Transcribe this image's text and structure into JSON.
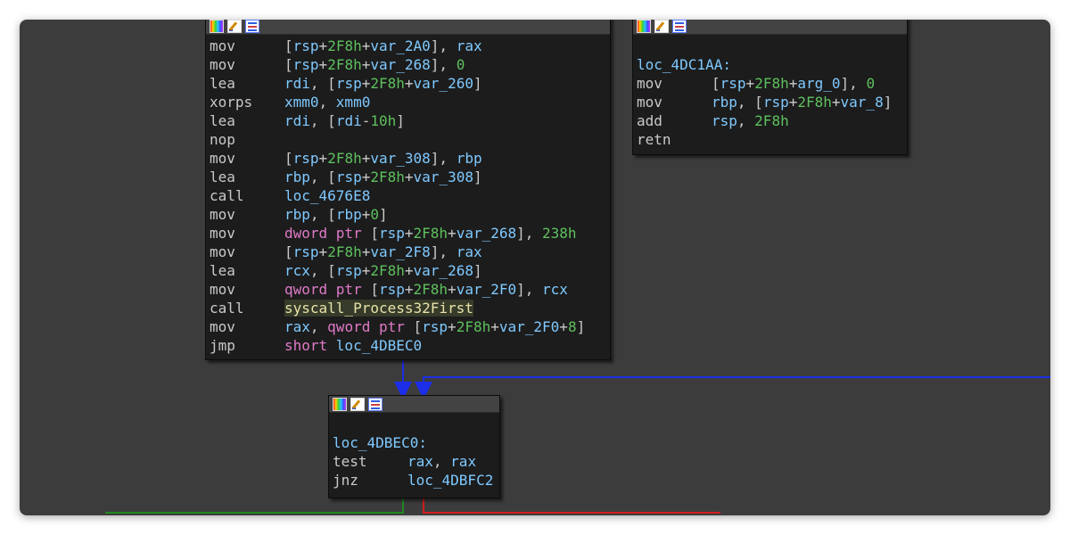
{
  "colors": {
    "canvas": "#3c3c3c",
    "node_bg": "#1c1c1c",
    "node_header": "#434343",
    "text": "#c9c9c9",
    "identifier": "#7fc9ff",
    "number": "#5ec05e",
    "keyword": "#e07ac8",
    "edge_unconditional": "#1c2ee8",
    "edge_true": "#1f8a1f",
    "edge_false": "#d21c1c"
  },
  "node_toolbar_icons": [
    "colors-icon",
    "rename-icon",
    "graph-overview-icon"
  ],
  "node_main": {
    "lines": [
      {
        "m": "mov",
        "ops": [
          [
            "br",
            "["
          ],
          [
            "reg",
            "rsp"
          ],
          [
            "t",
            "+"
          ],
          [
            "num",
            "2F8h"
          ],
          [
            "t",
            "+"
          ],
          [
            "id",
            "var_2A0"
          ],
          [
            "br",
            "], "
          ],
          [
            "reg",
            "rax"
          ]
        ]
      },
      {
        "m": "mov",
        "ops": [
          [
            "br",
            "["
          ],
          [
            "reg",
            "rsp"
          ],
          [
            "t",
            "+"
          ],
          [
            "num",
            "2F8h"
          ],
          [
            "t",
            "+"
          ],
          [
            "id",
            "var_268"
          ],
          [
            "br",
            "], "
          ],
          [
            "num",
            "0"
          ]
        ]
      },
      {
        "m": "lea",
        "ops": [
          [
            "reg",
            "rdi"
          ],
          [
            "t",
            ", ["
          ],
          [
            "reg",
            "rsp"
          ],
          [
            "t",
            "+"
          ],
          [
            "num",
            "2F8h"
          ],
          [
            "t",
            "+"
          ],
          [
            "id",
            "var_260"
          ],
          [
            "t",
            "]"
          ]
        ]
      },
      {
        "m": "xorps",
        "ops": [
          [
            "reg",
            "xmm0"
          ],
          [
            "t",
            ", "
          ],
          [
            "reg",
            "xmm0"
          ]
        ]
      },
      {
        "m": "lea",
        "ops": [
          [
            "reg",
            "rdi"
          ],
          [
            "t",
            ", ["
          ],
          [
            "reg",
            "rdi"
          ],
          [
            "t",
            "-"
          ],
          [
            "num",
            "10h"
          ],
          [
            "t",
            "]"
          ]
        ]
      },
      {
        "m": "nop",
        "ops": []
      },
      {
        "m": "mov",
        "ops": [
          [
            "br",
            "["
          ],
          [
            "reg",
            "rsp"
          ],
          [
            "t",
            "+"
          ],
          [
            "num",
            "2F8h"
          ],
          [
            "t",
            "+"
          ],
          [
            "id",
            "var_308"
          ],
          [
            "br",
            "], "
          ],
          [
            "reg",
            "rbp"
          ]
        ]
      },
      {
        "m": "lea",
        "ops": [
          [
            "reg",
            "rbp"
          ],
          [
            "t",
            ", ["
          ],
          [
            "reg",
            "rsp"
          ],
          [
            "t",
            "+"
          ],
          [
            "num",
            "2F8h"
          ],
          [
            "t",
            "+"
          ],
          [
            "id",
            "var_308"
          ],
          [
            "t",
            "]"
          ]
        ]
      },
      {
        "m": "call",
        "ops": [
          [
            "id",
            "loc_4676E8"
          ]
        ]
      },
      {
        "m": "mov",
        "ops": [
          [
            "reg",
            "rbp"
          ],
          [
            "t",
            ", ["
          ],
          [
            "reg",
            "rbp"
          ],
          [
            "t",
            "+"
          ],
          [
            "num",
            "0"
          ],
          [
            "t",
            "]"
          ]
        ]
      },
      {
        "m": "mov",
        "ops": [
          [
            "kw",
            "dword ptr "
          ],
          [
            "t",
            "["
          ],
          [
            "reg",
            "rsp"
          ],
          [
            "t",
            "+"
          ],
          [
            "num",
            "2F8h"
          ],
          [
            "t",
            "+"
          ],
          [
            "id",
            "var_268"
          ],
          [
            "t",
            "], "
          ],
          [
            "num",
            "238h"
          ]
        ]
      },
      {
        "m": "mov",
        "ops": [
          [
            "br",
            "["
          ],
          [
            "reg",
            "rsp"
          ],
          [
            "t",
            "+"
          ],
          [
            "num",
            "2F8h"
          ],
          [
            "t",
            "+"
          ],
          [
            "id",
            "var_2F8"
          ],
          [
            "br",
            "], "
          ],
          [
            "reg",
            "rax"
          ]
        ]
      },
      {
        "m": "lea",
        "ops": [
          [
            "reg",
            "rcx"
          ],
          [
            "t",
            ", ["
          ],
          [
            "reg",
            "rsp"
          ],
          [
            "t",
            "+"
          ],
          [
            "num",
            "2F8h"
          ],
          [
            "t",
            "+"
          ],
          [
            "id",
            "var_268"
          ],
          [
            "t",
            "]"
          ]
        ]
      },
      {
        "m": "mov",
        "ops": [
          [
            "kw",
            "qword ptr "
          ],
          [
            "t",
            "["
          ],
          [
            "reg",
            "rsp"
          ],
          [
            "t",
            "+"
          ],
          [
            "num",
            "2F8h"
          ],
          [
            "t",
            "+"
          ],
          [
            "id",
            "var_2F0"
          ],
          [
            "t",
            "], "
          ],
          [
            "reg",
            "rcx"
          ]
        ]
      },
      {
        "m": "call",
        "ops": [
          [
            "hl",
            "syscall_Process32First"
          ]
        ]
      },
      {
        "m": "mov",
        "ops": [
          [
            "reg",
            "rax"
          ],
          [
            "t",
            ", "
          ],
          [
            "kw",
            "qword ptr "
          ],
          [
            "t",
            "["
          ],
          [
            "reg",
            "rsp"
          ],
          [
            "t",
            "+"
          ],
          [
            "num",
            "2F8h"
          ],
          [
            "t",
            "+"
          ],
          [
            "id",
            "var_2F0"
          ],
          [
            "t",
            "+"
          ],
          [
            "num",
            "8"
          ],
          [
            "t",
            "]"
          ]
        ]
      },
      {
        "m": "jmp",
        "ops": [
          [
            "kw",
            "short "
          ],
          [
            "id",
            "loc_4DBEC0"
          ]
        ]
      }
    ]
  },
  "node_right": {
    "label": "loc_4DC1AA:",
    "lines": [
      {
        "m": "mov",
        "ops": [
          [
            "t",
            "["
          ],
          [
            "reg",
            "rsp"
          ],
          [
            "t",
            "+"
          ],
          [
            "num",
            "2F8h"
          ],
          [
            "t",
            "+"
          ],
          [
            "id",
            "arg_0"
          ],
          [
            "t",
            "], "
          ],
          [
            "num",
            "0"
          ]
        ]
      },
      {
        "m": "mov",
        "ops": [
          [
            "reg",
            "rbp"
          ],
          [
            "t",
            ", ["
          ],
          [
            "reg",
            "rsp"
          ],
          [
            "t",
            "+"
          ],
          [
            "num",
            "2F8h"
          ],
          [
            "t",
            "+"
          ],
          [
            "id",
            "var_8"
          ],
          [
            "t",
            "]"
          ]
        ]
      },
      {
        "m": "add",
        "ops": [
          [
            "reg",
            "rsp"
          ],
          [
            "t",
            ", "
          ],
          [
            "num",
            "2F8h"
          ]
        ]
      },
      {
        "m": "retn",
        "ops": []
      }
    ]
  },
  "node_bottom": {
    "label": "loc_4DBEC0:",
    "lines": [
      {
        "m": "test",
        "ops": [
          [
            "reg",
            "rax"
          ],
          [
            "t",
            ", "
          ],
          [
            "reg",
            "rax"
          ]
        ]
      },
      {
        "m": "jnz",
        "ops": [
          [
            "id",
            "loc_4DBFC2"
          ]
        ]
      }
    ]
  }
}
